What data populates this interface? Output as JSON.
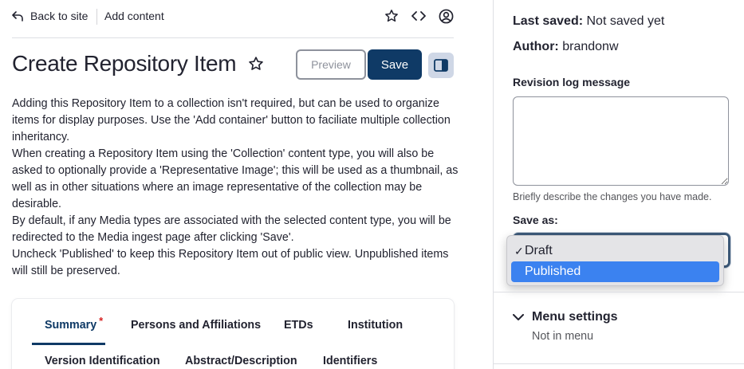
{
  "topbar": {
    "back_label": "Back to site",
    "crumb_label": "Add content",
    "icons": [
      "star-icon",
      "code-icon",
      "user-icon"
    ]
  },
  "page": {
    "title": "Create Repository Item",
    "preview_label": "Preview",
    "save_label": "Save"
  },
  "description": [
    "Adding this Repository Item to a collection isn't required, but can be used to organize items for display purposes. Use the 'Add container' button to faciliate multiple collection inheritancy.",
    "When creating a Repository Item using the 'Collection' content type, you will also be asked to optionally provide a 'Representative Image'; this will be used as a thumbnail, as well as in other situations where an image representative of the collection may be desirable.",
    "By default, if any Media types are associated with the selected content type, you will be redirected to the Media ingest page after clicking 'Save'.",
    "Uncheck 'Published' to keep this Repository Item out of public view. Unpublished items will still be preserved."
  ],
  "tabs": [
    {
      "label": "Summary",
      "required": "*"
    },
    {
      "label": "Persons and Affiliations"
    },
    {
      "label": "ETDs"
    },
    {
      "label": "Institution"
    },
    {
      "label": "Version Identification"
    },
    {
      "label": "Abstract/Description"
    },
    {
      "label": "Identifiers"
    }
  ],
  "sidebar": {
    "last_saved_label": "Last saved:",
    "last_saved_value": "Not saved yet",
    "author_label": "Author:",
    "author_value": "brandonw",
    "revision_label": "Revision log message",
    "revision_value": "",
    "revision_help": "Briefly describe the changes you have made.",
    "save_as_label": "Save as:",
    "save_as_options": [
      "Draft",
      "Published"
    ],
    "save_as_selected": "Draft",
    "save_as_highlighted": "Published",
    "menu_settings_label": "Menu settings",
    "menu_settings_summary": "Not in menu"
  },
  "colors": {
    "primary": "#0f3a66",
    "required": "#d72222",
    "highlight": "#3b82f0"
  }
}
